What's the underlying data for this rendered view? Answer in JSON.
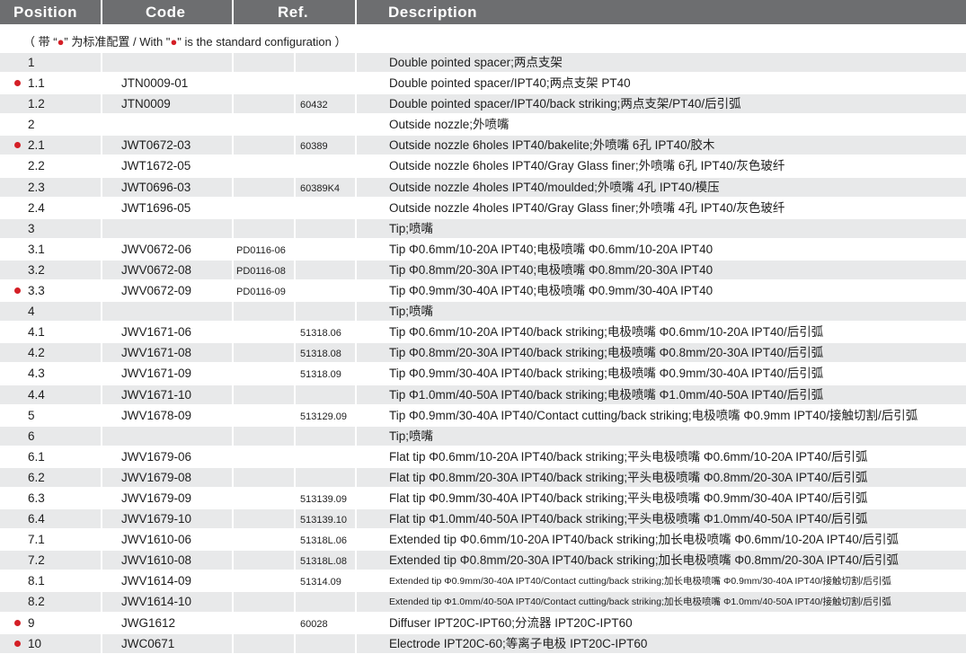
{
  "header": {
    "position": "Position",
    "code": "Code",
    "ref": "Ref.",
    "description": "Description"
  },
  "note": {
    "prefix": "（ 带 “",
    "dot1": "●",
    "mid": "” 为标准配置 / With \"",
    "dot2": "●",
    "suffix": "\" is the standard configuration ）"
  },
  "colors": {
    "header_bg": "#6d6e70",
    "stripe": "#e8e9ea",
    "bullet": "#d41f26"
  },
  "rows": [
    {
      "pos": "1",
      "code": "",
      "ref": "",
      "ref2": "",
      "desc": "Double pointed spacer;两点支架",
      "std": false
    },
    {
      "pos": "1.1",
      "code": "JTN0009-01",
      "ref": "",
      "ref2": "",
      "desc": "Double pointed spacer/IPT40;两点支架 PT40",
      "std": true
    },
    {
      "pos": "1.2",
      "code": "JTN0009",
      "ref": "",
      "ref2": "60432",
      "desc": "Double pointed spacer/IPT40/back striking;两点支架/PT40/后引弧",
      "std": false
    },
    {
      "pos": "2",
      "code": "",
      "ref": "",
      "ref2": "",
      "desc": "Outside nozzle;外喷嘴",
      "std": false
    },
    {
      "pos": "2.1",
      "code": "JWT0672-03",
      "ref": "",
      "ref2": "60389",
      "desc": "Outside nozzle 6holes IPT40/bakelite;外喷嘴 6孔 IPT40/胶木",
      "std": true
    },
    {
      "pos": "2.2",
      "code": "JWT1672-05",
      "ref": "",
      "ref2": "",
      "desc": "Outside nozzle 6holes IPT40/Gray Glass finer;外喷嘴 6孔 IPT40/灰色玻纤",
      "std": false
    },
    {
      "pos": "2.3",
      "code": "JWT0696-03",
      "ref": "",
      "ref2": "60389K4",
      "desc": "Outside nozzle 4holes IPT40/moulded;外喷嘴 4孔 IPT40/模压",
      "std": false
    },
    {
      "pos": "2.4",
      "code": "JWT1696-05",
      "ref": "",
      "ref2": "",
      "desc": "Outside nozzle 4holes IPT40/Gray Glass finer;外喷嘴 4孔 IPT40/灰色玻纤",
      "std": false
    },
    {
      "pos": "3",
      "code": "",
      "ref": "",
      "ref2": "",
      "desc": "Tip;喷嘴",
      "std": false
    },
    {
      "pos": "3.1",
      "code": "JWV0672-06",
      "ref": "PD0116-06",
      "ref2": "",
      "desc": "Tip Φ0.6mm/10-20A IPT40;电极喷嘴 Φ0.6mm/10-20A IPT40",
      "std": false
    },
    {
      "pos": "3.2",
      "code": "JWV0672-08",
      "ref": "PD0116-08",
      "ref2": "",
      "desc": "Tip Φ0.8mm/20-30A IPT40;电极喷嘴 Φ0.8mm/20-30A IPT40",
      "std": false
    },
    {
      "pos": "3.3",
      "code": "JWV0672-09",
      "ref": "PD0116-09",
      "ref2": "",
      "desc": "Tip Φ0.9mm/30-40A IPT40;电极喷嘴 Φ0.9mm/30-40A IPT40",
      "std": true
    },
    {
      "pos": "4",
      "code": "",
      "ref": "",
      "ref2": "",
      "desc": "Tip;喷嘴",
      "std": false
    },
    {
      "pos": "4.1",
      "code": "JWV1671-06",
      "ref": "",
      "ref2": "51318.06",
      "desc": "Tip Φ0.6mm/10-20A IPT40/back striking;电极喷嘴 Φ0.6mm/10-20A IPT40/后引弧",
      "std": false
    },
    {
      "pos": "4.2",
      "code": "JWV1671-08",
      "ref": "",
      "ref2": "51318.08",
      "desc": "Tip Φ0.8mm/20-30A IPT40/back striking;电极喷嘴 Φ0.8mm/20-30A IPT40/后引弧",
      "std": false
    },
    {
      "pos": "4.3",
      "code": "JWV1671-09",
      "ref": "",
      "ref2": "51318.09",
      "desc": "Tip Φ0.9mm/30-40A IPT40/back striking;电极喷嘴 Φ0.9mm/30-40A IPT40/后引弧",
      "std": false
    },
    {
      "pos": "4.4",
      "code": "JWV1671-10",
      "ref": "",
      "ref2": "",
      "desc": "Tip Φ1.0mm/40-50A IPT40/back striking;电极喷嘴 Φ1.0mm/40-50A IPT40/后引弧",
      "std": false
    },
    {
      "pos": "5",
      "code": "JWV1678-09",
      "ref": "",
      "ref2": "513129.09",
      "desc": "Tip Φ0.9mm/30-40A IPT40/Contact cutting/back striking;电极喷嘴 Φ0.9mm IPT40/接触切割/后引弧",
      "std": false
    },
    {
      "pos": "6",
      "code": "",
      "ref": "",
      "ref2": "",
      "desc": "Tip;喷嘴",
      "std": false
    },
    {
      "pos": "6.1",
      "code": "JWV1679-06",
      "ref": "",
      "ref2": "",
      "desc": "Flat tip Φ0.6mm/10-20A IPT40/back striking;平头电极喷嘴 Φ0.6mm/10-20A IPT40/后引弧",
      "std": false
    },
    {
      "pos": "6.2",
      "code": "JWV1679-08",
      "ref": "",
      "ref2": "",
      "desc": "Flat tip Φ0.8mm/20-30A IPT40/back striking;平头电极喷嘴 Φ0.8mm/20-30A IPT40/后引弧",
      "std": false
    },
    {
      "pos": "6.3",
      "code": "JWV1679-09",
      "ref": "",
      "ref2": "513139.09",
      "desc": "Flat tip Φ0.9mm/30-40A IPT40/back striking;平头电极喷嘴 Φ0.9mm/30-40A IPT40/后引弧",
      "std": false
    },
    {
      "pos": "6.4",
      "code": "JWV1679-10",
      "ref": "",
      "ref2": "513139.10",
      "desc": "Flat tip Φ1.0mm/40-50A IPT40/back striking;平头电极喷嘴 Φ1.0mm/40-50A IPT40/后引弧",
      "std": false
    },
    {
      "pos": "7.1",
      "code": "JWV1610-06",
      "ref": "",
      "ref2": "51318L.06",
      "desc": "Extended tip Φ0.6mm/10-20A IPT40/back striking;加长电极喷嘴 Φ0.6mm/10-20A IPT40/后引弧",
      "std": false
    },
    {
      "pos": "7.2",
      "code": "JWV1610-08",
      "ref": "",
      "ref2": "51318L.08",
      "desc": "Extended tip Φ0.8mm/20-30A IPT40/back striking;加长电极喷嘴 Φ0.8mm/20-30A IPT40/后引弧",
      "std": false
    },
    {
      "pos": "8.1",
      "code": "JWV1614-09",
      "ref": "",
      "ref2": "51314.09",
      "desc": "Extended tip Φ0.9mm/30-40A IPT40/Contact cutting/back striking;加长电极喷嘴 Φ0.9mm/30-40A IPT40/接触切割/后引弧",
      "std": false,
      "small": true
    },
    {
      "pos": "8.2",
      "code": "JWV1614-10",
      "ref": "",
      "ref2": "",
      "desc": "Extended tip Φ1.0mm/40-50A IPT40/Contact cutting/back striking;加长电极喷嘴 Φ1.0mm/40-50A IPT40/接触切割/后引弧",
      "std": false,
      "small": true
    },
    {
      "pos": "9",
      "code": "JWG1612",
      "ref": "",
      "ref2": "60028",
      "desc": "Diffuser IPT20C-IPT60;分流器 IPT20C-IPT60",
      "std": true
    },
    {
      "pos": "10",
      "code": "JWC0671",
      "ref": "",
      "ref2": "",
      "desc": "Electrode IPT20C-60;等离子电极 IPT20C-IPT60",
      "std": true
    }
  ]
}
